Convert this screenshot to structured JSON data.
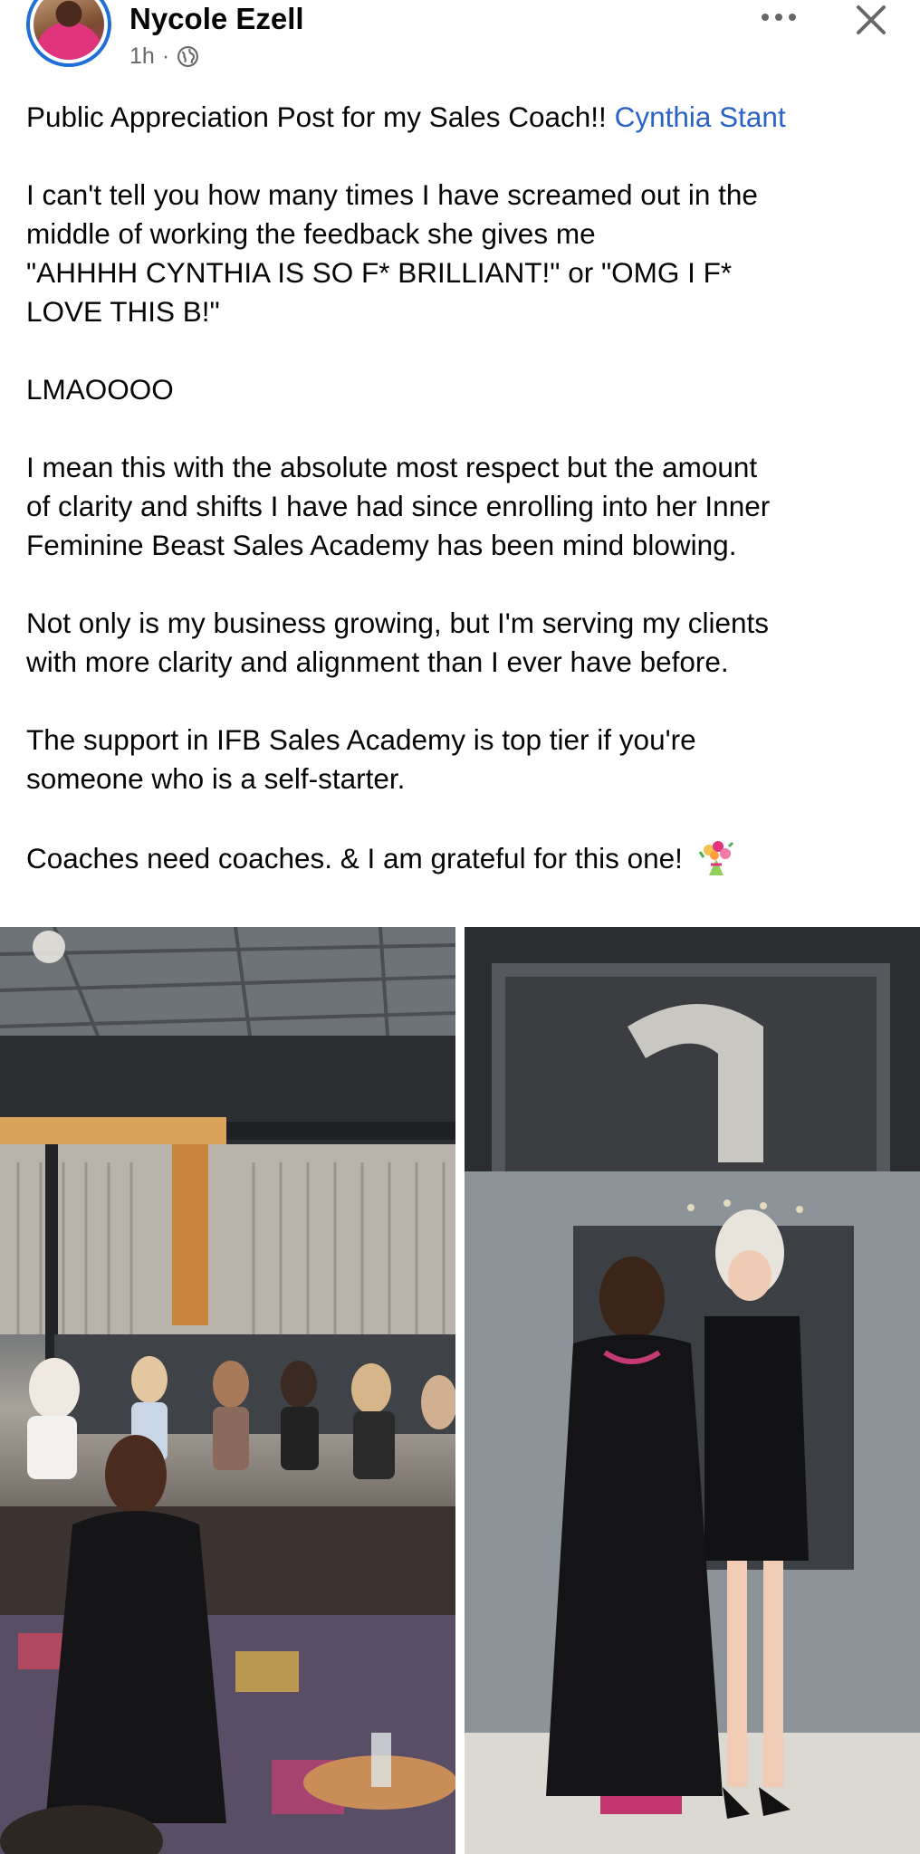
{
  "post": {
    "author": "Nycole Ezell",
    "time": "1h",
    "separator": "·",
    "privacy_icon": "globe-icon",
    "more_icon": "more-horizontal-icon",
    "close_icon": "close-icon",
    "title_line": "Public Appreciation Post for my Sales Coach!!",
    "mention": "Cynthia Stant",
    "para1_line1": "I can't tell you how many times I have screamed out in the",
    "para1_line2": "middle of working the feedback she gives me",
    "para1_line3": "\"AHHHH CYNTHIA IS SO F* BRILLIANT!\" or \"OMG I F*",
    "para1_line4": "LOVE THIS B!\"",
    "para2": "LMAOOOO",
    "para3_line1": "I mean this with the absolute most respect but the amount",
    "para3_line2": "of clarity and shifts I have had since enrolling into her Inner",
    "para3_line3": "Feminine Beast Sales Academy has been mind blowing.",
    "para4_line1": "Not only is my business growing, but I'm serving my clients",
    "para4_line2": "with more clarity and alignment than I ever have before.",
    "para5_line1": "The support in IFB Sales Academy is top tier if you're",
    "para5_line2": "someone who is a self-starter.",
    "para6": "Coaches need coaches. & I am grateful for this one!",
    "emoji": "bouquet-emoji"
  },
  "colors": {
    "mention": "#2a62c7",
    "meta_gray": "#65676b",
    "avatar_ring": "#1f6fd6"
  }
}
